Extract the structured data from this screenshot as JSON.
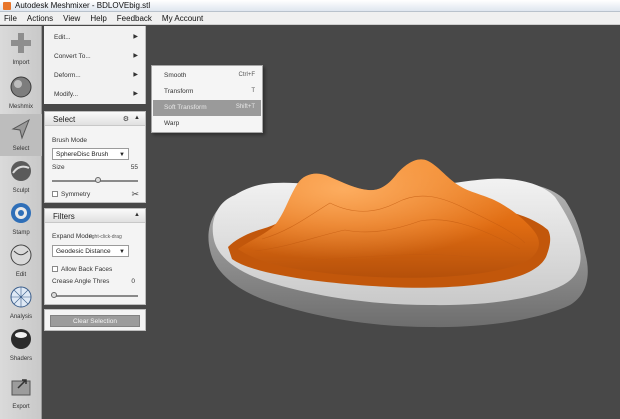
{
  "window": {
    "title": "Autodesk Meshmixer - BDLOVEbig.stl"
  },
  "menubar": [
    "File",
    "Actions",
    "View",
    "Help",
    "Feedback",
    "My Account"
  ],
  "toolbar": [
    {
      "label": "Import",
      "icon": "plus-icon"
    },
    {
      "label": "Meshmix",
      "icon": "meshmix-sphere-icon"
    },
    {
      "label": "Select",
      "icon": "arrow-cursor-icon",
      "active": true
    },
    {
      "label": "Sculpt",
      "icon": "sculpt-brush-icon"
    },
    {
      "label": "Stamp",
      "icon": "stamp-icon"
    },
    {
      "label": "Edit",
      "icon": "edit-sphere-icon"
    },
    {
      "label": "Analysis",
      "icon": "analysis-sphere-icon"
    },
    {
      "label": "Shaders",
      "icon": "shaders-sphere-icon"
    },
    {
      "label": "Export",
      "icon": "export-icon"
    }
  ],
  "flyout": [
    "Edit...",
    "Convert To...",
    "Deform...",
    "Modify..."
  ],
  "submenu": [
    {
      "label": "Smooth",
      "shortcut": "Ctrl+F"
    },
    {
      "label": "Transform",
      "shortcut": "T"
    },
    {
      "label": "Soft Transform",
      "shortcut": "Shift+T",
      "highlighted": true
    },
    {
      "label": "Warp",
      "shortcut": ""
    }
  ],
  "select_panel": {
    "title": "Select",
    "brush_mode_label": "Brush Mode",
    "brush_mode_value": "SphereDisc Brush",
    "size_label": "Size",
    "size_value": "55",
    "size_fraction": 0.55,
    "symmetry_label": "Symmetry"
  },
  "filters_panel": {
    "title": "Filters",
    "expand_mode_label": "Expand Mode",
    "expand_mode_hint": "right-click-drag",
    "expand_mode_value": "Geodesic Distance",
    "allow_back_faces_label": "Allow Back Faces",
    "crease_angle_label": "Crease Angle Thres",
    "crease_angle_value": "0",
    "crease_angle_fraction": 0.0
  },
  "actions": {
    "clear_selection": "Clear Selection"
  },
  "colors": {
    "selection": "#e8731e",
    "mesh": "#d8d8d8",
    "viewport": "#484848"
  }
}
